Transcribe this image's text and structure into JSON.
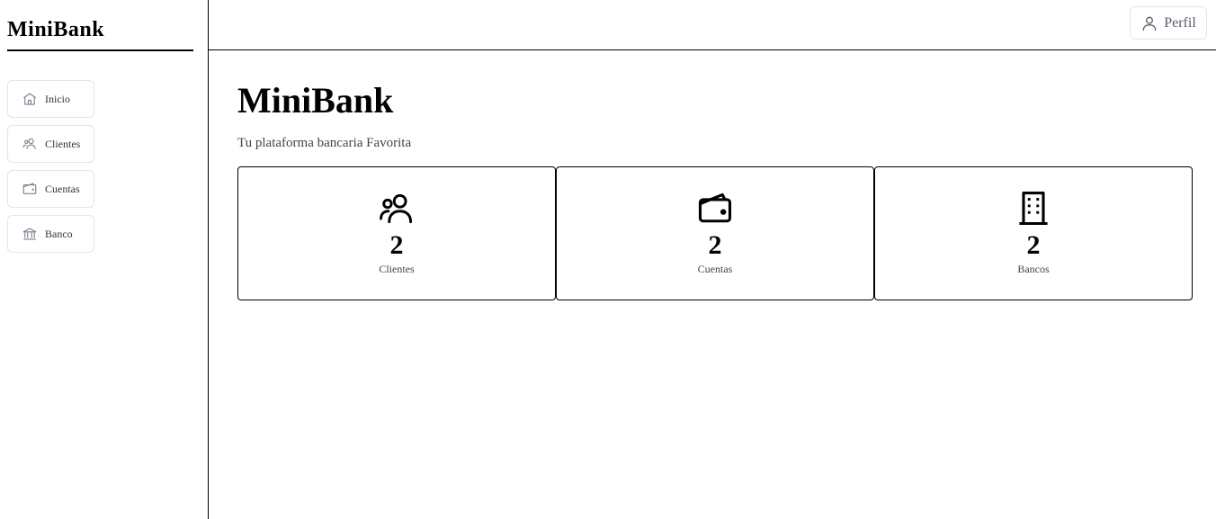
{
  "sidebar": {
    "brand": "MiniBank",
    "items": [
      {
        "label": "Inicio",
        "icon": "home-icon"
      },
      {
        "label": "Clientes",
        "icon": "users-icon"
      },
      {
        "label": "Cuentas",
        "icon": "wallet-icon"
      },
      {
        "label": "Banco",
        "icon": "bank-icon"
      }
    ]
  },
  "header": {
    "profile_label": "Perfil",
    "profile_icon": "user-icon"
  },
  "main": {
    "title": "MiniBank",
    "subtitle": "Tu plataforma bancaria Favorita",
    "cards": [
      {
        "value": "2",
        "label": "Clientes",
        "icon": "users-icon"
      },
      {
        "value": "2",
        "label": "Cuentas",
        "icon": "wallet-icon"
      },
      {
        "value": "2",
        "label": "Bancos",
        "icon": "building-icon"
      }
    ]
  },
  "colors": {
    "border_light": "#e3e5ea",
    "icon_gray": "#6b7280",
    "text_dark": "#000000"
  }
}
